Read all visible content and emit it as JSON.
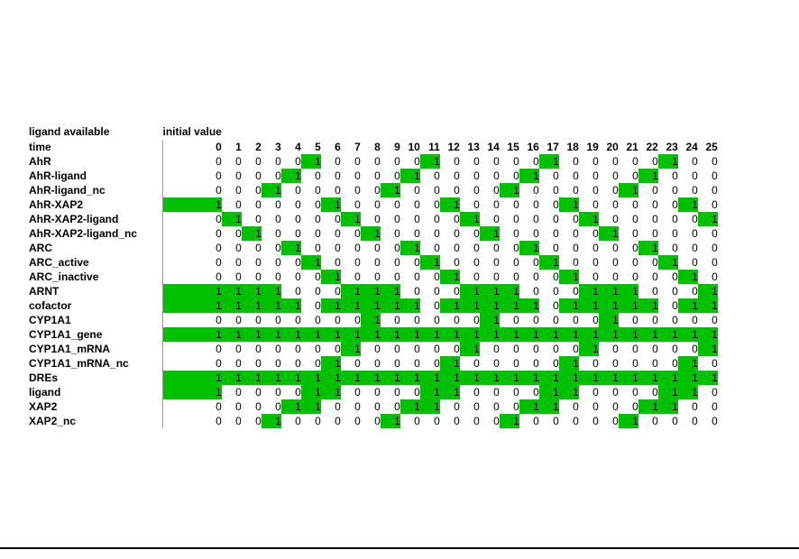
{
  "header": {
    "label_column_title": "ligand available",
    "initial_value_title": "initial value",
    "time_row_label": "time"
  },
  "colors": {
    "on": "#00c000",
    "off": "#ffffff",
    "text": "#000000",
    "grid": "#c8c8c8",
    "divider": "#9a9a9a"
  },
  "chart_data": {
    "type": "heatmap",
    "title": "ligand available",
    "xlabel": "time",
    "ylabel": "",
    "grid": false,
    "legend": "none",
    "value_labels": true,
    "colormap": {
      "0": "#ffffff",
      "1": "#00c000"
    },
    "x": [
      0,
      1,
      2,
      3,
      4,
      5,
      6,
      7,
      8,
      9,
      10,
      11,
      12,
      13,
      14,
      15,
      16,
      17,
      18,
      19,
      20,
      21,
      22,
      23,
      24,
      25
    ],
    "xtick_labels": [
      "0",
      "1",
      "2",
      "3",
      "4",
      "5",
      "6",
      "7",
      "8",
      "9",
      "10",
      "11",
      "12",
      "13",
      "14",
      "15",
      "16",
      "17",
      "18",
      "19",
      "20",
      "21",
      "22",
      "23",
      "24",
      "25"
    ],
    "categories": [
      "AhR",
      "AhR-ligand",
      "AhR-ligand_nc",
      "AhR-XAP2",
      "AhR-XAP2-ligand",
      "AhR-XAP2-ligand_nc",
      "ARC",
      "ARC_active",
      "ARC_inactive",
      "ARNT",
      "cofactor",
      "CYP1A1",
      "CYP1A1_gene",
      "CYP1A1_mRNA",
      "CYP1A1_mRNA_nc",
      "DREs",
      "ligand",
      "XAP2",
      "XAP2_nc"
    ],
    "series": [
      {
        "name": "AhR",
        "initial": 0,
        "values": [
          0,
          0,
          0,
          0,
          0,
          1,
          0,
          0,
          0,
          0,
          0,
          1,
          0,
          0,
          0,
          0,
          0,
          1,
          0,
          0,
          0,
          0,
          0,
          1,
          0,
          0
        ]
      },
      {
        "name": "AhR-ligand",
        "initial": 0,
        "values": [
          0,
          0,
          0,
          0,
          1,
          0,
          0,
          0,
          0,
          0,
          1,
          0,
          0,
          0,
          0,
          0,
          1,
          0,
          0,
          0,
          0,
          0,
          1,
          0,
          0,
          0
        ]
      },
      {
        "name": "AhR-ligand_nc",
        "initial": 0,
        "values": [
          0,
          0,
          0,
          1,
          0,
          0,
          0,
          0,
          0,
          1,
          0,
          0,
          0,
          0,
          0,
          1,
          0,
          0,
          0,
          0,
          0,
          1,
          0,
          0,
          0,
          0
        ]
      },
      {
        "name": "AhR-XAP2",
        "initial": 1,
        "values": [
          1,
          0,
          0,
          0,
          0,
          0,
          1,
          0,
          0,
          0,
          0,
          0,
          1,
          0,
          0,
          0,
          0,
          0,
          1,
          0,
          0,
          0,
          0,
          0,
          1,
          0
        ]
      },
      {
        "name": "AhR-XAP2-ligand",
        "initial": 0,
        "values": [
          0,
          1,
          0,
          0,
          0,
          0,
          0,
          1,
          0,
          0,
          0,
          0,
          0,
          1,
          0,
          0,
          0,
          0,
          0,
          1,
          0,
          0,
          0,
          0,
          0,
          1
        ]
      },
      {
        "name": "AhR-XAP2-ligand_nc",
        "initial": 0,
        "values": [
          0,
          0,
          1,
          0,
          0,
          0,
          0,
          0,
          1,
          0,
          0,
          0,
          0,
          0,
          1,
          0,
          0,
          0,
          0,
          0,
          1,
          0,
          0,
          0,
          0,
          0
        ]
      },
      {
        "name": "ARC",
        "initial": 0,
        "values": [
          0,
          0,
          0,
          0,
          1,
          0,
          0,
          0,
          0,
          0,
          1,
          0,
          0,
          0,
          0,
          0,
          1,
          0,
          0,
          0,
          0,
          0,
          1,
          0,
          0,
          0
        ]
      },
      {
        "name": "ARC_active",
        "initial": 0,
        "values": [
          0,
          0,
          0,
          0,
          0,
          1,
          0,
          0,
          0,
          0,
          0,
          1,
          0,
          0,
          0,
          0,
          0,
          1,
          0,
          0,
          0,
          0,
          0,
          1,
          0,
          0
        ]
      },
      {
        "name": "ARC_inactive",
        "initial": 0,
        "values": [
          0,
          0,
          0,
          0,
          0,
          0,
          1,
          0,
          0,
          0,
          0,
          0,
          1,
          0,
          0,
          0,
          0,
          0,
          1,
          0,
          0,
          0,
          0,
          0,
          1,
          0
        ]
      },
      {
        "name": "ARNT",
        "initial": 1,
        "values": [
          1,
          1,
          1,
          1,
          0,
          0,
          0,
          1,
          1,
          1,
          0,
          0,
          0,
          1,
          1,
          1,
          0,
          0,
          0,
          1,
          1,
          1,
          0,
          0,
          0,
          1
        ]
      },
      {
        "name": "cofactor",
        "initial": 1,
        "values": [
          1,
          1,
          1,
          1,
          1,
          0,
          1,
          1,
          1,
          1,
          1,
          0,
          1,
          1,
          1,
          1,
          1,
          0,
          1,
          1,
          1,
          1,
          1,
          0,
          1,
          1
        ]
      },
      {
        "name": "CYP1A1",
        "initial": 0,
        "values": [
          0,
          0,
          0,
          0,
          0,
          0,
          0,
          0,
          1,
          0,
          0,
          0,
          0,
          0,
          1,
          0,
          0,
          0,
          0,
          0,
          1,
          0,
          0,
          0,
          0,
          0
        ]
      },
      {
        "name": "CYP1A1_gene",
        "initial": 1,
        "values": [
          1,
          1,
          1,
          1,
          1,
          1,
          1,
          1,
          1,
          1,
          1,
          1,
          1,
          1,
          1,
          1,
          1,
          1,
          1,
          1,
          1,
          1,
          1,
          1,
          1,
          1
        ]
      },
      {
        "name": "CYP1A1_mRNA",
        "initial": 0,
        "values": [
          0,
          0,
          0,
          0,
          0,
          0,
          0,
          1,
          0,
          0,
          0,
          0,
          0,
          1,
          0,
          0,
          0,
          0,
          0,
          1,
          0,
          0,
          0,
          0,
          0,
          1
        ]
      },
      {
        "name": "CYP1A1_mRNA_nc",
        "initial": 0,
        "values": [
          0,
          0,
          0,
          0,
          0,
          0,
          1,
          0,
          0,
          0,
          0,
          0,
          1,
          0,
          0,
          0,
          0,
          0,
          1,
          0,
          0,
          0,
          0,
          0,
          1,
          0
        ]
      },
      {
        "name": "DREs",
        "initial": 1,
        "values": [
          1,
          1,
          1,
          1,
          1,
          1,
          1,
          1,
          1,
          1,
          1,
          1,
          1,
          1,
          1,
          1,
          1,
          1,
          1,
          1,
          1,
          1,
          1,
          1,
          1,
          1
        ]
      },
      {
        "name": "ligand",
        "initial": 1,
        "values": [
          1,
          0,
          0,
          0,
          0,
          1,
          1,
          0,
          0,
          0,
          0,
          1,
          1,
          0,
          0,
          0,
          0,
          1,
          1,
          0,
          0,
          0,
          0,
          1,
          1,
          0
        ]
      },
      {
        "name": "XAP2",
        "initial": 0,
        "values": [
          0,
          0,
          0,
          0,
          1,
          1,
          0,
          0,
          0,
          0,
          1,
          1,
          0,
          0,
          0,
          0,
          1,
          1,
          0,
          0,
          0,
          0,
          1,
          1,
          0,
          0
        ]
      },
      {
        "name": "XAP2_nc",
        "initial": 0,
        "values": [
          0,
          0,
          0,
          1,
          0,
          0,
          0,
          0,
          0,
          1,
          0,
          0,
          0,
          0,
          0,
          1,
          0,
          0,
          0,
          0,
          0,
          1,
          0,
          0,
          0,
          0
        ]
      }
    ]
  }
}
